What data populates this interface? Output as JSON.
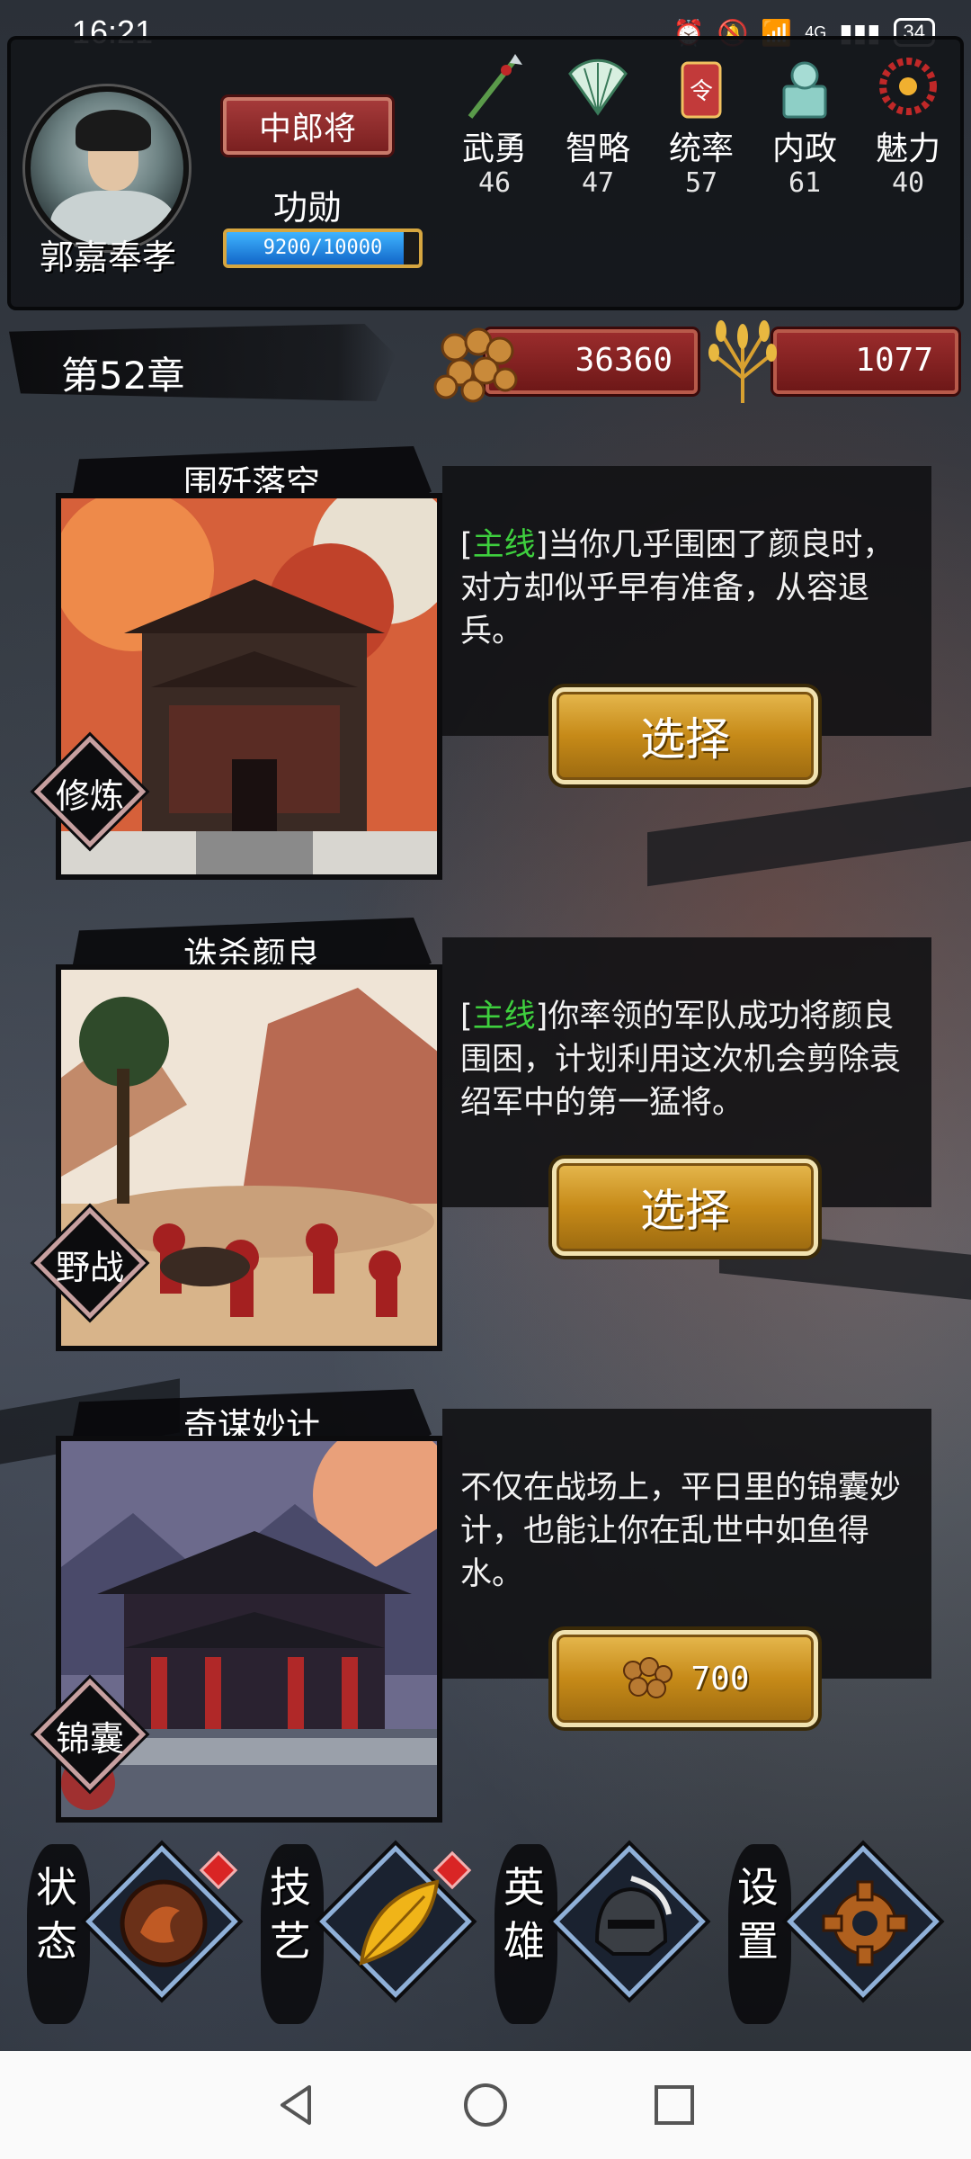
{
  "status_bar": {
    "time": "16:21",
    "network": "4G",
    "battery": "34"
  },
  "hero": {
    "name": "郭嘉奉孝",
    "rank": "中郎将",
    "merit_label": "功勋",
    "merit_text": "9200/10000",
    "merit_progress": 0.92
  },
  "stats": [
    {
      "label": "武勇",
      "value": "46",
      "icon": "spear-icon"
    },
    {
      "label": "智略",
      "value": "47",
      "icon": "fan-icon"
    },
    {
      "label": "统率",
      "value": "57",
      "icon": "command-token-icon"
    },
    {
      "label": "内政",
      "value": "61",
      "icon": "seal-icon"
    },
    {
      "label": "魅力",
      "value": "40",
      "icon": "necklace-icon"
    }
  ],
  "chapter": {
    "title": "第52章",
    "coins": "36360",
    "grain": "1077"
  },
  "quests": [
    {
      "title": "围歼落空",
      "tag_label": "主线",
      "description": "当你几乎围困了颜良时，对方却似乎早有准备，从容退兵。",
      "category": "修炼",
      "button_label": "选择"
    },
    {
      "title": "诛杀颜良",
      "tag_label": "主线",
      "description": "你率领的军队成功将颜良围困，计划利用这次机会剪除袁绍军中的第一猛将。",
      "category": "野战",
      "button_label": "选择"
    },
    {
      "title": "奇谋妙计",
      "tag_label": "",
      "description": "不仅在战场上，平日里的锦囊妙计，也能让你在乱世中如鱼得水。",
      "category": "锦囊",
      "cost": "700"
    }
  ],
  "bottom_nav": [
    {
      "label": "状态",
      "icon": "dragon-emblem-icon",
      "badge": true
    },
    {
      "label": "技艺",
      "icon": "golden-leaf-icon",
      "badge": true
    },
    {
      "label": "英雄",
      "icon": "helmet-icon",
      "badge": false
    },
    {
      "label": "设置",
      "icon": "gear-icon",
      "badge": false
    }
  ],
  "colors": {
    "tag_green": "#3ecf3e",
    "button_gold": "#c68a18",
    "resource_red": "#9a2c2c",
    "merit_blue": "#1e8ef0"
  }
}
